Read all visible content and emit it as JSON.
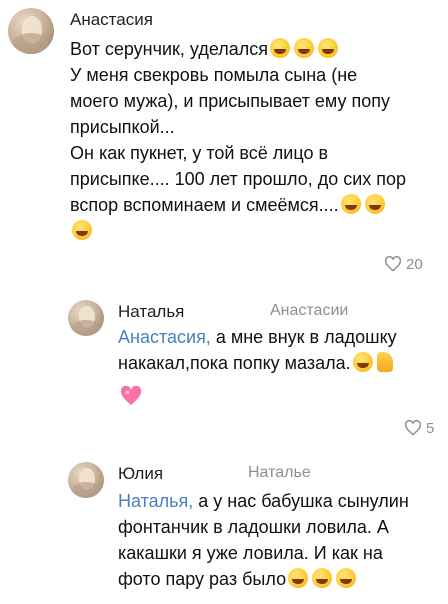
{
  "comments": [
    {
      "author": "Анастасия",
      "text_lines": [
        "Вот серунчик, уделался",
        "У меня свекровь помыла сына (не",
        "моего мужа), и присыпывает ему попу",
        "присыпкой...",
        "Он как пукнет, у той всё лицо в",
        "присыпке.... 100 лет прошло, до сих пор",
        "вспор вспоминаем и смеёмся...."
      ],
      "likes": "20"
    },
    {
      "author": "Наталья",
      "reply_to": "Анастасии",
      "mention": "Анастасия,",
      "text_lines": [
        " а мне внук в ладошку",
        "накакал,пока попку мазала."
      ],
      "likes": "5"
    },
    {
      "author": "Юлия",
      "reply_to": "Наталье",
      "mention": "Наталья,",
      "text_lines": [
        " а у нас бабушка сынулин",
        "фонтанчик в ладошки ловила. А",
        "какашки я уже ловила. И как на",
        "фото пару раз было"
      ]
    }
  ],
  "icons": {
    "emoji": "rofl-emoji",
    "thumb": "thumbs-up-emoji",
    "heart": "pink-heart-emoji",
    "like": "heart-outline-icon"
  },
  "colors": {
    "mention": "#4a7fc1",
    "secondary": "#8a8f96"
  }
}
